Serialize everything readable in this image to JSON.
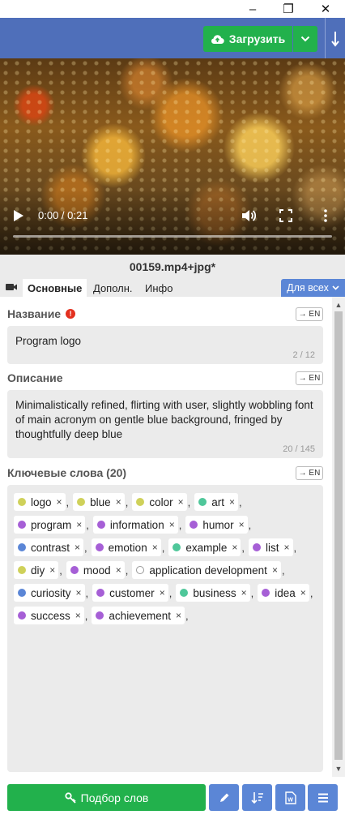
{
  "window": {
    "minimize": "–",
    "maximize": "❐",
    "close": "✕"
  },
  "toolbar": {
    "upload_label": "Загрузить"
  },
  "video": {
    "time": "0:00 / 0:21",
    "progress": 0
  },
  "file": {
    "name": "00159.mp4+jpg*"
  },
  "tabs": {
    "main": "Основные",
    "extra": "Дополн.",
    "info": "Инфо",
    "for_all": "Для всех"
  },
  "title_section": {
    "label": "Название",
    "en": "→ EN",
    "value": "Program logo",
    "counter": "2 / 12"
  },
  "description_section": {
    "label": "Описание",
    "en": "→ EN",
    "value": "Minimalistically refined, flirting with user, slightly wobbling font of main acronym on gentle blue background, fringed by thoughtfully deep blue",
    "counter": "20 / 145"
  },
  "keywords_section": {
    "label": "Ключевые слова (20)",
    "en": "→ EN",
    "items": [
      {
        "text": "logo",
        "color": "#cfd15a"
      },
      {
        "text": "blue",
        "color": "#cfd15a"
      },
      {
        "text": "color",
        "color": "#cfd15a"
      },
      {
        "text": "art",
        "color": "#4fc79a"
      },
      {
        "text": "program",
        "color": "#a65fd6"
      },
      {
        "text": "information",
        "color": "#a65fd6"
      },
      {
        "text": "humor",
        "color": "#a65fd6"
      },
      {
        "text": "contrast",
        "color": "#5b86d6"
      },
      {
        "text": "emotion",
        "color": "#a65fd6"
      },
      {
        "text": "example",
        "color": "#4fc79a"
      },
      {
        "text": "list",
        "color": "#a65fd6"
      },
      {
        "text": "diy",
        "color": "#cfd15a"
      },
      {
        "text": "mood",
        "color": "#a65fd6"
      },
      {
        "text": "application development",
        "color": "#ffffff"
      },
      {
        "text": "curiosity",
        "color": "#5b86d6"
      },
      {
        "text": "customer",
        "color": "#a65fd6"
      },
      {
        "text": "business",
        "color": "#4fc79a"
      },
      {
        "text": "idea",
        "color": "#a65fd6"
      },
      {
        "text": "success",
        "color": "#a65fd6"
      },
      {
        "text": "achievement",
        "color": "#a65fd6"
      }
    ]
  },
  "bottom": {
    "match_label": "Подбор слов"
  },
  "colors": {
    "accent_blue": "#5b86d6",
    "green": "#22b14c",
    "header": "#4f6fba"
  }
}
